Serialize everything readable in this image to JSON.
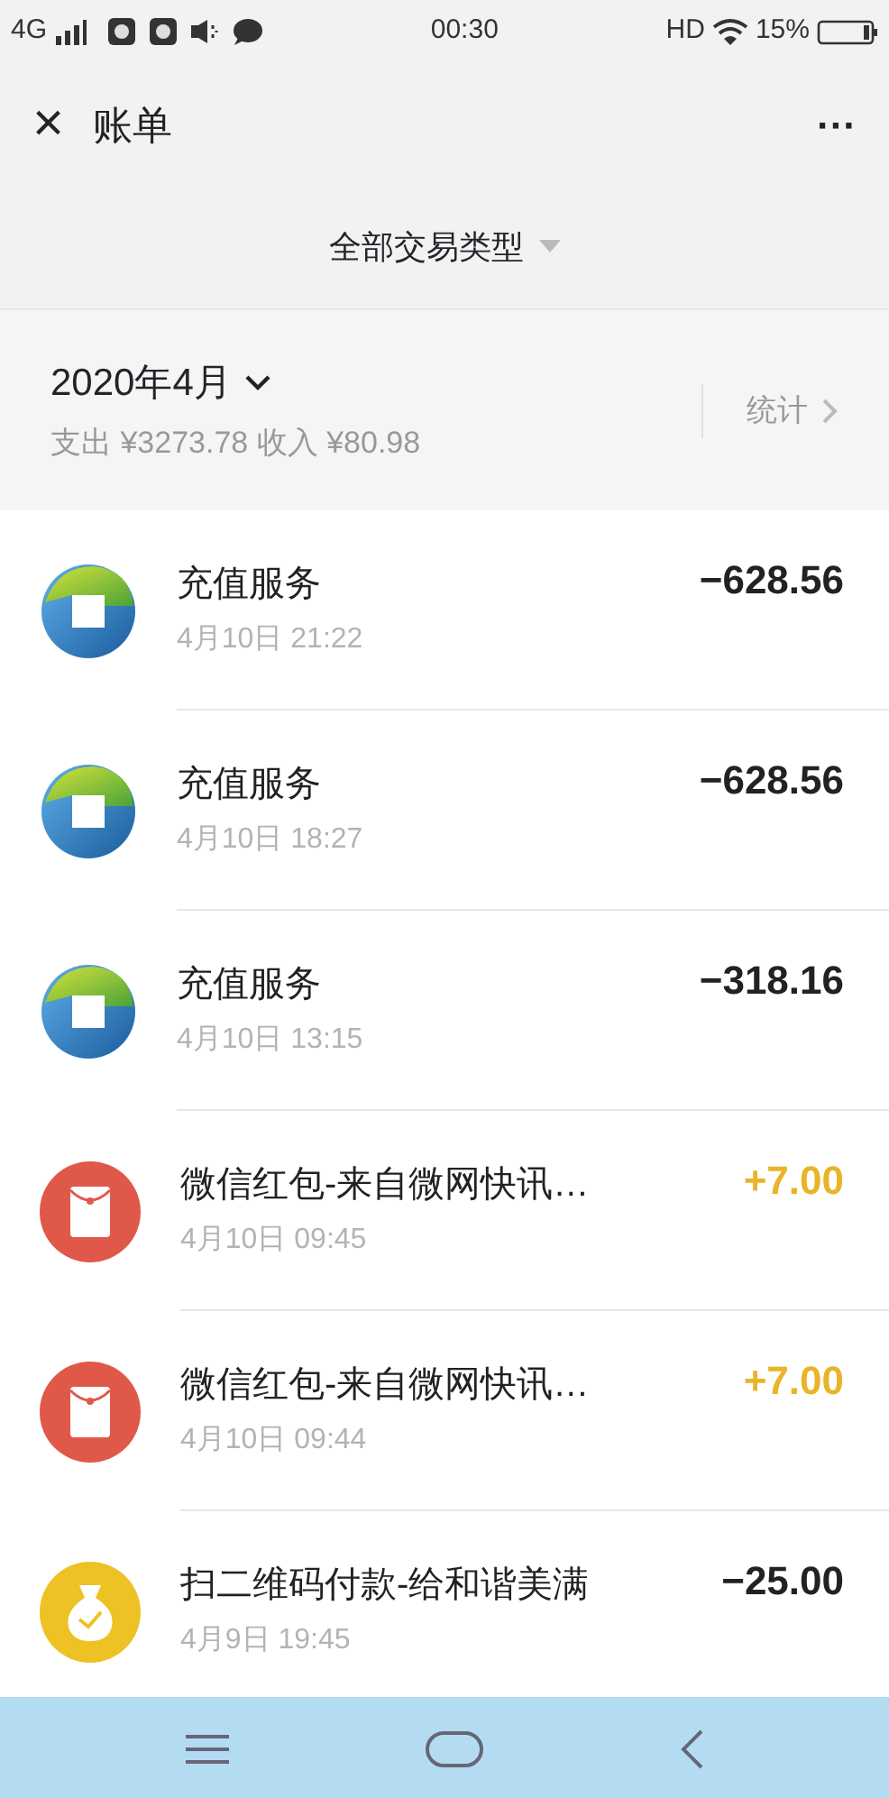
{
  "status_bar": {
    "network": "4G",
    "time": "00:30",
    "hd": "HD",
    "battery": "15%"
  },
  "header": {
    "close": "×",
    "title": "账单",
    "more": "···"
  },
  "filter": {
    "label": "全部交易类型"
  },
  "month": {
    "title": "2020年4月",
    "summary": "支出 ¥3273.78 收入 ¥80.98",
    "stats": "统计"
  },
  "transactions": [
    {
      "kind": "recharge",
      "title": "充值服务",
      "time": "4月10日 21:22",
      "amount": "−628.56",
      "income": false
    },
    {
      "kind": "recharge",
      "title": "充值服务",
      "time": "4月10日 18:27",
      "amount": "−628.56",
      "income": false
    },
    {
      "kind": "recharge",
      "title": "充值服务",
      "time": "4月10日 13:15",
      "amount": "−318.16",
      "income": false
    },
    {
      "kind": "red-packet",
      "title": "微信红包-来自微网快讯…",
      "time": "4月10日 09:45",
      "amount": "+7.00",
      "income": true
    },
    {
      "kind": "red-packet",
      "title": "微信红包-来自微网快讯…",
      "time": "4月10日 09:44",
      "amount": "+7.00",
      "income": true
    },
    {
      "kind": "payment",
      "title": "扫二维码付款-给和谐美满",
      "time": "4月9日 19:45",
      "amount": "−25.00",
      "income": false
    }
  ]
}
